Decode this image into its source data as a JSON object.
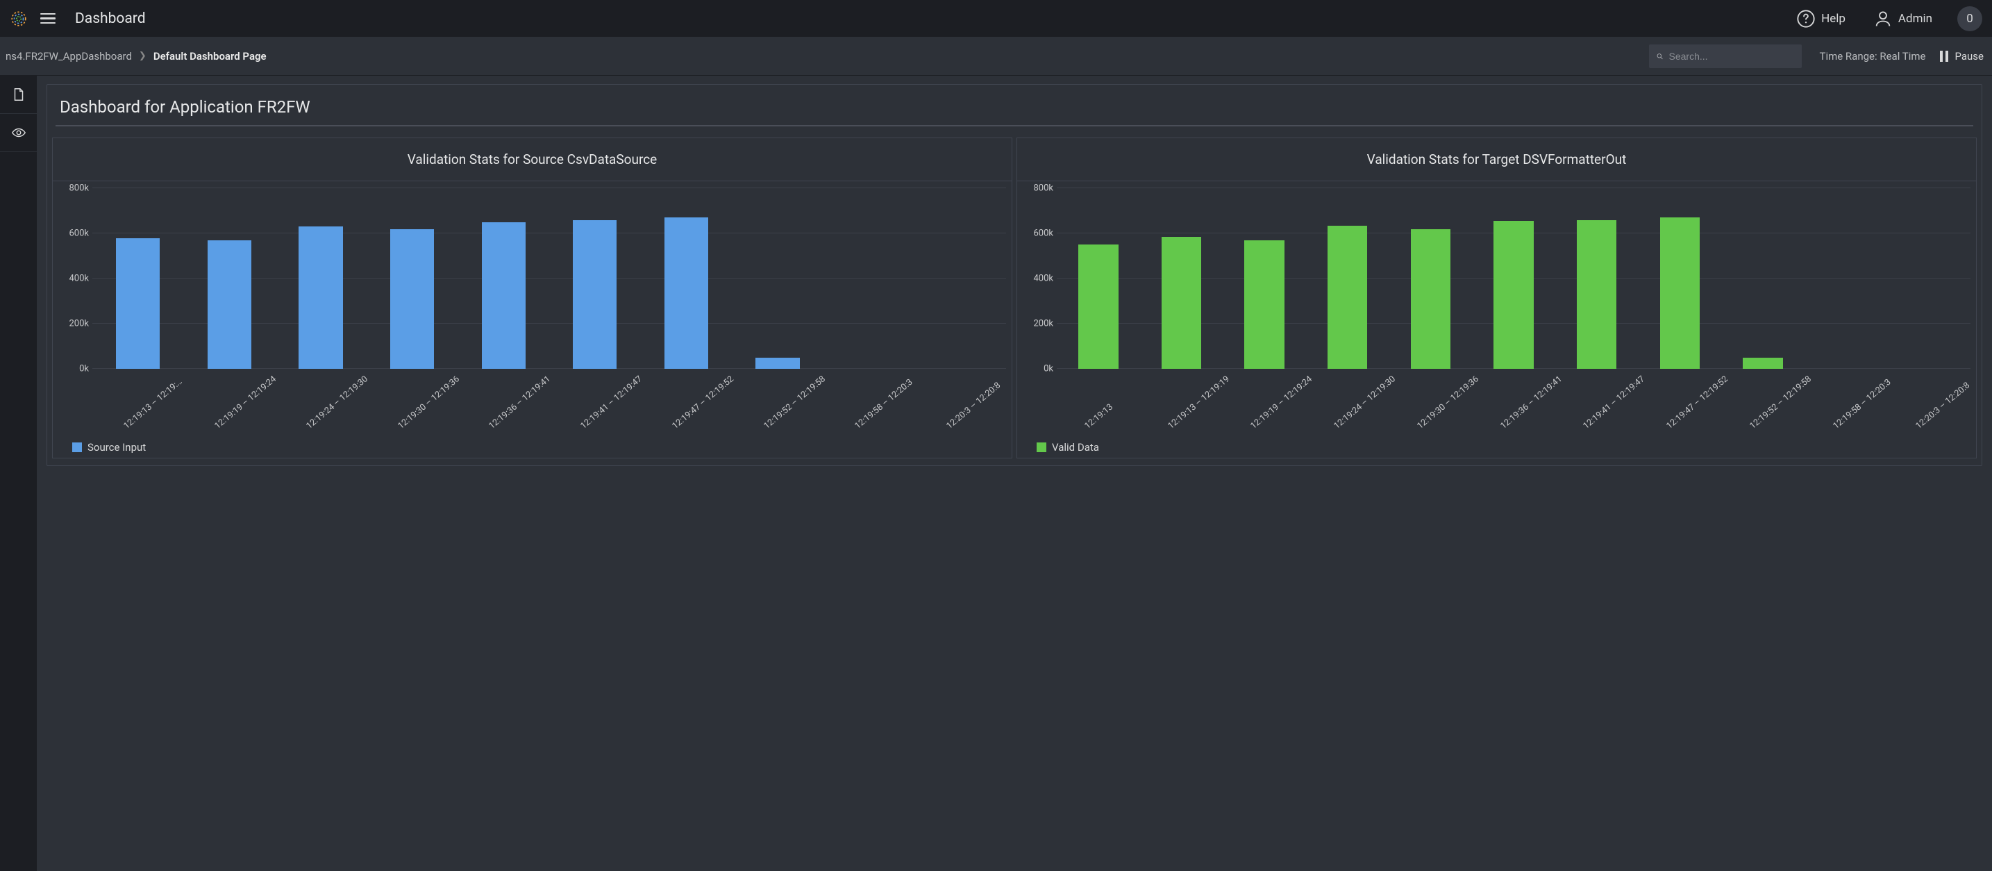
{
  "header": {
    "title": "Dashboard",
    "help_label": "Help",
    "admin_label": "Admin",
    "badge_count": "0"
  },
  "subheader": {
    "breadcrumb_root": "ns4.FR2FW_AppDashboard",
    "breadcrumb_current": "Default Dashboard Page",
    "search_placeholder": "Search...",
    "time_range_label": "Time Range: Real Time",
    "pause_label": "Pause"
  },
  "panel": {
    "title": "Dashboard for Application FR2FW"
  },
  "colors": {
    "source": "#5b9ee6",
    "valid": "#63c84b"
  },
  "chart_data": [
    {
      "type": "bar",
      "title": "Validation Stats for Source CsvDataSource",
      "legend": "Source Input",
      "color_key": "source",
      "ylim": [
        0,
        800000
      ],
      "yticks": [
        "0k",
        "200k",
        "400k",
        "600k",
        "800k"
      ],
      "categories": [
        "12:19:13 – 12:19:…",
        "12:19:19 – 12:19:24",
        "12:19:24 – 12:19:30",
        "12:19:30 – 12:19:36",
        "12:19:36 – 12:19:41",
        "12:19:41 – 12:19:47",
        "12:19:47 – 12:19:52",
        "12:19:52 – 12:19:58",
        "12:19:58 – 12:20:3",
        "12:20:3 – 12:20:8"
      ],
      "values": [
        580000,
        570000,
        630000,
        620000,
        650000,
        660000,
        670000,
        50000,
        0,
        0
      ]
    },
    {
      "type": "bar",
      "title": "Validation Stats for Target DSVFormatterOut",
      "legend": "Valid Data",
      "color_key": "valid",
      "ylim": [
        0,
        800000
      ],
      "yticks": [
        "0k",
        "200k",
        "400k",
        "600k",
        "800k"
      ],
      "categories": [
        "12:19:13",
        "12:19:13 – 12:19:19",
        "12:19:19 – 12:19:24",
        "12:19:24 – 12:19:30",
        "12:19:30 – 12:19:36",
        "12:19:36 – 12:19:41",
        "12:19:41 – 12:19:47",
        "12:19:47 – 12:19:52",
        "12:19:52 – 12:19:58",
        "12:19:58 – 12:20:3",
        "12:20:3 – 12:20:8"
      ],
      "values": [
        550000,
        585000,
        570000,
        635000,
        620000,
        655000,
        660000,
        670000,
        50000,
        0,
        0
      ]
    }
  ]
}
